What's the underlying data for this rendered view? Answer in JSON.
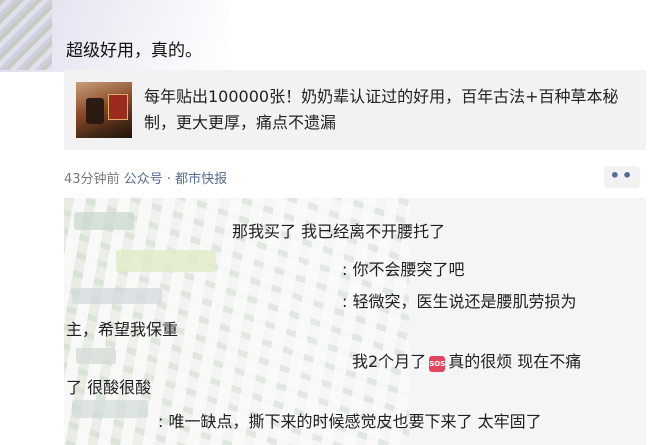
{
  "post": {
    "text": "超级好用，真的。"
  },
  "article": {
    "title": "每年贴出100000张！奶奶辈认证过的好用，百年古法+百种草本秘制，更大更厚，痛点不遗漏"
  },
  "meta": {
    "time": "43分钟前",
    "source_type": "公众号",
    "separator": "·",
    "source_name": "都市快报",
    "more": "••"
  },
  "comments": {
    "line1": "那我买了 我已经离不开腰托了",
    "line2": ": 你不会腰突了吧",
    "line3": ": 轻微突，医生说还是腰肌劳损为",
    "line4": "主，希望我保重",
    "line5a": "我2个月了",
    "sos_icon_text": "SOS",
    "line5b": "真的很烦 现在不痛",
    "line6": "了 很酸很酸",
    "line7": ": 唯一缺点，撕下来的时候感觉皮也要下来了 太牢固了"
  }
}
